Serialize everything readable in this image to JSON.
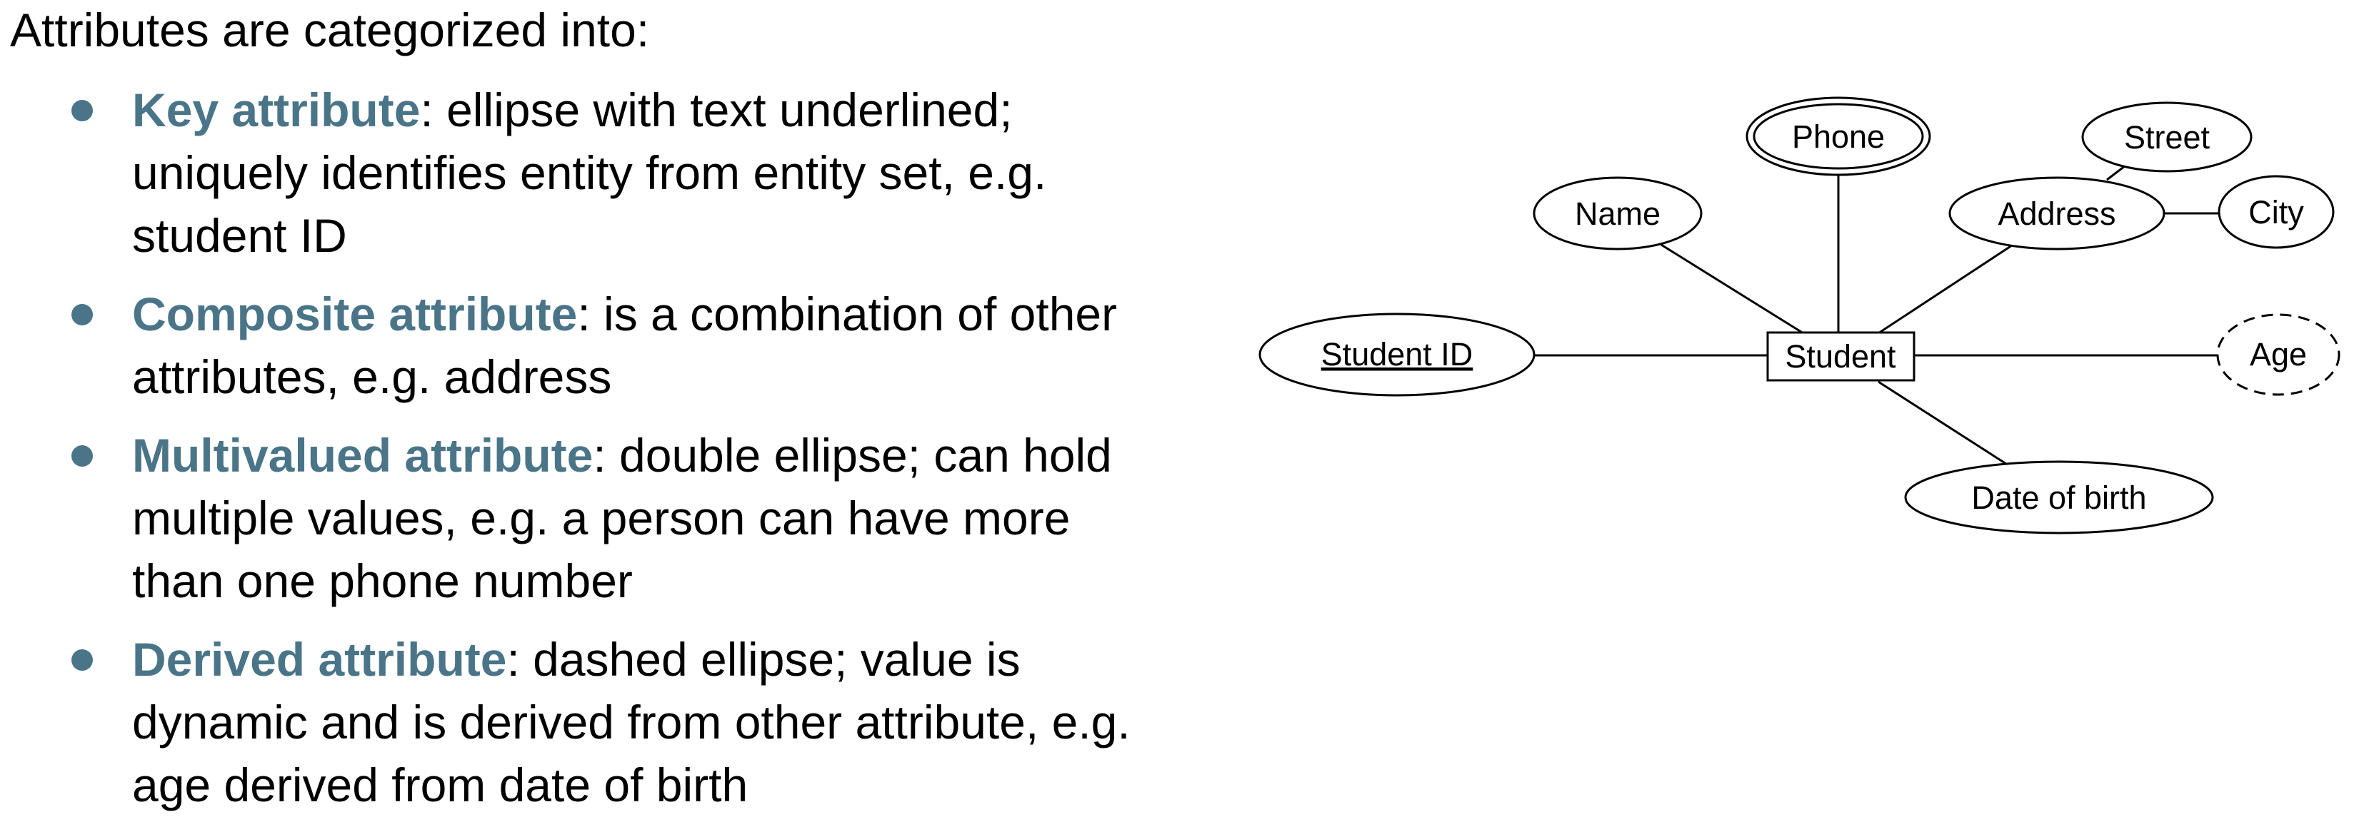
{
  "intro": "Attributes are categorized into:",
  "bullets": [
    {
      "term": "Key attribute",
      "lines": [
        ": ellipse with text underlined;",
        "uniquely identifies entity from entity set, e.g.",
        "student ID"
      ]
    },
    {
      "term": "Composite attribute",
      "lines": [
        ": is a combination of other",
        "attributes, e.g. address"
      ]
    },
    {
      "term": "Multivalued attribute",
      "lines": [
        ": double ellipse; can hold",
        "multiple values, e.g. a person can have more",
        "than one phone number"
      ]
    },
    {
      "term": "Derived attribute",
      "lines": [
        ": dashed ellipse; value is",
        "dynamic and is derived from other attribute, e.g.",
        "age derived from date of birth"
      ]
    }
  ],
  "diagram": {
    "entity": "Student",
    "attributes": {
      "phone": "Phone",
      "street": "Street",
      "name": "Name",
      "address": "Address",
      "city": "City",
      "student_id": "Student ID",
      "age": "Age",
      "date_of_birth": "Date of birth"
    }
  },
  "colors": {
    "term": "#4a7588",
    "bullet": "#4a7588",
    "text": "#000000"
  }
}
